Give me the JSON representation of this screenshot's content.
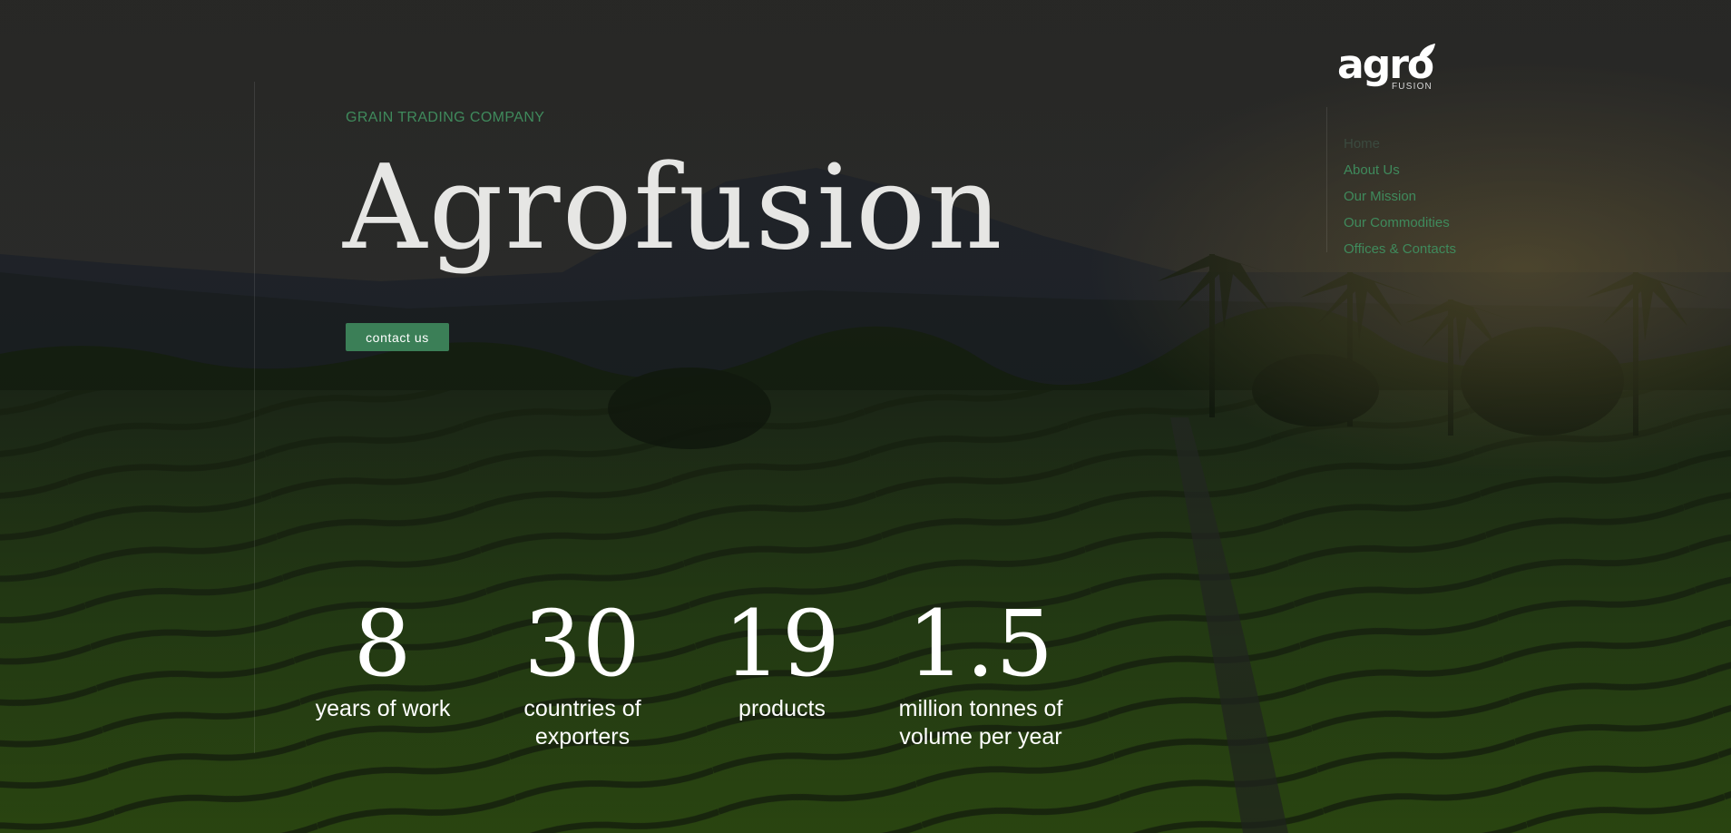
{
  "hero": {
    "kicker": "GRAIN TRADING COMPANY",
    "title": "Agrofusion",
    "cta_label": "contact us"
  },
  "logo": {
    "word": "agro",
    "sub": "FUSION",
    "leaf_color": "#ffffff"
  },
  "nav": {
    "items": [
      {
        "label": "Home",
        "active": true
      },
      {
        "label": "About Us",
        "active": false
      },
      {
        "label": "Our Mission",
        "active": false
      },
      {
        "label": "Our Commodities",
        "active": false
      },
      {
        "label": "Offices & Contacts",
        "active": false
      }
    ]
  },
  "stats": [
    {
      "value": "8",
      "label_line1": "years of work",
      "label_line2": ""
    },
    {
      "value": "30",
      "label_line1": "countries of",
      "label_line2": "exporters"
    },
    {
      "value": "19",
      "label_line1": "products",
      "label_line2": ""
    },
    {
      "value": "1.5",
      "label_line1": "million tonnes of",
      "label_line2": "volume per year"
    }
  ],
  "colors": {
    "accent_green": "#3b7f57",
    "nav_green": "#3f8a5c",
    "title_white": "#e6e6e4"
  },
  "icons": {
    "logo_leaf": "leaf-icon"
  }
}
